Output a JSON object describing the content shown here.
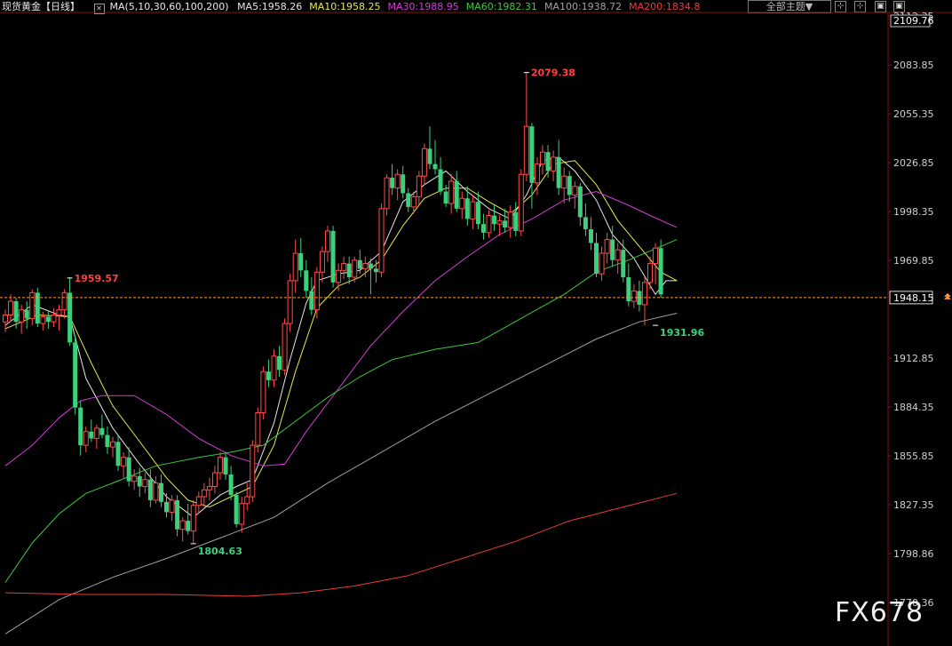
{
  "header": {
    "title": "现货黄金",
    "period": "【日线】",
    "ma_params": "MA(5,10,30,60,100,200)",
    "ma_values": [
      {
        "label": "MA5:1958.26",
        "color": "#e6e6e6"
      },
      {
        "label": "MA10:1958.25",
        "color": "#e8e84a"
      },
      {
        "label": "MA30:1988.95",
        "color": "#d43cd4"
      },
      {
        "label": "MA60:1982.31",
        "color": "#3cc83c"
      },
      {
        "label": "MA100:1938.72",
        "color": "#a0a0a0"
      },
      {
        "label": "MA200:1834.8",
        "color": "#e83c3c"
      }
    ],
    "theme_selector": "全部主题▼",
    "tools": [
      "⊹",
      "⊹",
      "▣",
      "▣"
    ]
  },
  "watermark": "FX678",
  "chart_data": {
    "type": "candlestick",
    "title": "",
    "xlabel": "",
    "ylabel": "",
    "ylim": [
      1770.36,
      2112.35
    ],
    "y_ticks": [
      2112.35,
      2083.85,
      2055.35,
      2026.85,
      1998.35,
      1969.85,
      1912.85,
      1884.35,
      1855.85,
      1827.35,
      1798.86,
      1770.36
    ],
    "top_value": "2109.76",
    "current_price": "1948.15",
    "annotations": [
      {
        "text": "2079.38",
        "value": 2079.38,
        "index": 97,
        "color": "#ff4040",
        "kind": "high"
      },
      {
        "text": "1959.57",
        "value": 1959.57,
        "index": 12,
        "color": "#ff4040",
        "kind": "high"
      },
      {
        "text": "1804.63",
        "value": 1804.63,
        "index": 35,
        "color": "#40d080",
        "kind": "low"
      },
      {
        "text": "1931.96",
        "value": 1931.96,
        "index": 121,
        "color": "#40d080",
        "kind": "low"
      }
    ],
    "candles": [
      [
        1934,
        1941,
        1928,
        1938
      ],
      [
        1938,
        1950,
        1934,
        1946
      ],
      [
        1946,
        1948,
        1930,
        1934
      ],
      [
        1934,
        1944,
        1927,
        1941
      ],
      [
        1941,
        1946,
        1930,
        1936
      ],
      [
        1936,
        1953,
        1932,
        1951
      ],
      [
        1951,
        1954,
        1931,
        1933
      ],
      [
        1933,
        1940,
        1929,
        1937
      ],
      [
        1937,
        1940,
        1930,
        1934
      ],
      [
        1934,
        1942,
        1931,
        1938
      ],
      [
        1938,
        1944,
        1929,
        1941
      ],
      [
        1941,
        1953,
        1936,
        1951
      ],
      [
        1951,
        1960,
        1920,
        1922
      ],
      [
        1922,
        1926,
        1880,
        1884
      ],
      [
        1884,
        1888,
        1856,
        1862
      ],
      [
        1862,
        1873,
        1858,
        1870
      ],
      [
        1870,
        1877,
        1864,
        1866
      ],
      [
        1866,
        1874,
        1860,
        1872
      ],
      [
        1872,
        1880,
        1866,
        1868
      ],
      [
        1868,
        1873,
        1857,
        1861
      ],
      [
        1861,
        1867,
        1855,
        1864
      ],
      [
        1864,
        1868,
        1847,
        1850
      ],
      [
        1850,
        1858,
        1843,
        1855
      ],
      [
        1855,
        1861,
        1838,
        1841
      ],
      [
        1841,
        1848,
        1836,
        1844
      ],
      [
        1844,
        1849,
        1832,
        1838
      ],
      [
        1838,
        1846,
        1834,
        1842
      ],
      [
        1842,
        1848,
        1826,
        1830
      ],
      [
        1830,
        1844,
        1828,
        1840
      ],
      [
        1840,
        1845,
        1826,
        1829
      ],
      [
        1829,
        1834,
        1820,
        1823
      ],
      [
        1823,
        1833,
        1818,
        1830
      ],
      [
        1830,
        1833,
        1809,
        1813
      ],
      [
        1813,
        1820,
        1806,
        1818
      ],
      [
        1818,
        1828,
        1810,
        1812
      ],
      [
        1812,
        1830,
        1805,
        1827
      ],
      [
        1827,
        1835,
        1822,
        1832
      ],
      [
        1832,
        1840,
        1826,
        1836
      ],
      [
        1836,
        1843,
        1830,
        1838
      ],
      [
        1838,
        1850,
        1834,
        1846
      ],
      [
        1846,
        1858,
        1842,
        1855
      ],
      [
        1855,
        1858,
        1842,
        1845
      ],
      [
        1845,
        1850,
        1830,
        1833
      ],
      [
        1833,
        1835,
        1814,
        1816
      ],
      [
        1816,
        1832,
        1811,
        1828
      ],
      [
        1828,
        1840,
        1824,
        1832
      ],
      [
        1832,
        1865,
        1829,
        1862
      ],
      [
        1862,
        1884,
        1858,
        1881
      ],
      [
        1881,
        1908,
        1877,
        1905
      ],
      [
        1905,
        1912,
        1896,
        1900
      ],
      [
        1900,
        1918,
        1896,
        1914
      ],
      [
        1914,
        1920,
        1902,
        1906
      ],
      [
        1906,
        1936,
        1903,
        1933
      ],
      [
        1933,
        1962,
        1928,
        1958
      ],
      [
        1958,
        1982,
        1951,
        1974
      ],
      [
        1974,
        1983,
        1960,
        1964
      ],
      [
        1964,
        1970,
        1948,
        1952
      ],
      [
        1952,
        1960,
        1938,
        1941
      ],
      [
        1941,
        1966,
        1936,
        1963
      ],
      [
        1963,
        1978,
        1957,
        1975
      ],
      [
        1975,
        1990,
        1969,
        1987
      ],
      [
        1987,
        1990,
        1954,
        1957
      ],
      [
        1957,
        1968,
        1952,
        1964
      ],
      [
        1964,
        1972,
        1959,
        1968
      ],
      [
        1968,
        1972,
        1956,
        1960
      ],
      [
        1960,
        1972,
        1957,
        1970
      ],
      [
        1970,
        1976,
        1962,
        1965
      ],
      [
        1965,
        1972,
        1960,
        1968
      ],
      [
        1968,
        1971,
        1950,
        1965
      ],
      [
        1965,
        1970,
        1957,
        1963
      ],
      [
        1963,
        2003,
        1960,
        2000
      ],
      [
        2000,
        2020,
        1996,
        2018
      ],
      [
        2018,
        2026,
        2008,
        2012
      ],
      [
        2012,
        2023,
        2005,
        2020
      ],
      [
        2020,
        2025,
        2006,
        2009
      ],
      [
        2009,
        2012,
        1998,
        2001
      ],
      [
        2001,
        2010,
        1997,
        2007
      ],
      [
        2007,
        2022,
        2002,
        2019
      ],
      [
        2019,
        2038,
        2014,
        2035
      ],
      [
        2035,
        2048,
        2023,
        2026
      ],
      [
        2026,
        2040,
        2020,
        2023
      ],
      [
        2023,
        2030,
        2008,
        2010
      ],
      [
        2010,
        2014,
        2001,
        2003
      ],
      [
        2003,
        2020,
        1997,
        2016
      ],
      [
        2016,
        2022,
        1998,
        2000
      ],
      [
        2000,
        2010,
        1994,
        2006
      ],
      [
        2006,
        2013,
        1990,
        1994
      ],
      [
        1994,
        2008,
        1988,
        2004
      ],
      [
        2004,
        2010,
        1988,
        1991
      ],
      [
        1991,
        1997,
        1982,
        1986
      ],
      [
        1986,
        1999,
        1983,
        1996
      ],
      [
        1996,
        2002,
        1987,
        1991
      ],
      [
        1991,
        1996,
        1984,
        1993
      ],
      [
        1993,
        2000,
        1986,
        1989
      ],
      [
        1989,
        2002,
        1983,
        1998
      ],
      [
        1998,
        2004,
        1984,
        1987
      ],
      [
        1987,
        2023,
        1984,
        2020
      ],
      [
        2020,
        2079,
        2016,
        2048
      ],
      [
        2048,
        2050,
        2000,
        2015
      ],
      [
        2015,
        2030,
        2008,
        2026
      ],
      [
        2026,
        2037,
        2020,
        2033
      ],
      [
        2033,
        2037,
        2018,
        2022
      ],
      [
        2022,
        2034,
        2016,
        2030
      ],
      [
        2030,
        2040,
        2008,
        2012
      ],
      [
        2012,
        2024,
        2003,
        2019
      ],
      [
        2019,
        2022,
        2004,
        2008
      ],
      [
        2008,
        2016,
        2000,
        2013
      ],
      [
        2013,
        2015,
        1990,
        1995
      ],
      [
        1995,
        2003,
        1984,
        1988
      ],
      [
        1988,
        1995,
        1976,
        1980
      ],
      [
        1980,
        1986,
        1960,
        1962
      ],
      [
        1962,
        1978,
        1958,
        1974
      ],
      [
        1974,
        1986,
        1968,
        1982
      ],
      [
        1982,
        1990,
        1966,
        1970
      ],
      [
        1970,
        1980,
        1962,
        1976
      ],
      [
        1976,
        1982,
        1957,
        1960
      ],
      [
        1960,
        1968,
        1943,
        1946
      ],
      [
        1946,
        1956,
        1942,
        1952
      ],
      [
        1952,
        1958,
        1940,
        1944
      ],
      [
        1944,
        1960,
        1932,
        1957
      ],
      [
        1957,
        1972,
        1953,
        1968
      ],
      [
        1968,
        1980,
        1956,
        1977
      ],
      [
        1977,
        1982,
        1948,
        1950
      ]
    ],
    "ma_series": [
      {
        "name": "MA5",
        "color": "#e6e6e6",
        "points": [
          [
            0,
            1932
          ],
          [
            5,
            1944
          ],
          [
            10,
            1938
          ],
          [
            12,
            1937
          ],
          [
            15,
            1901
          ],
          [
            20,
            1872
          ],
          [
            25,
            1851
          ],
          [
            30,
            1832
          ],
          [
            35,
            1820
          ],
          [
            40,
            1833
          ],
          [
            43,
            1838
          ],
          [
            46,
            1842
          ],
          [
            50,
            1875
          ],
          [
            53,
            1912
          ],
          [
            56,
            1945
          ],
          [
            58,
            1958
          ],
          [
            62,
            1962
          ],
          [
            66,
            1964
          ],
          [
            70,
            1975
          ],
          [
            74,
            2004
          ],
          [
            78,
            2014
          ],
          [
            82,
            2022
          ],
          [
            86,
            2010
          ],
          [
            90,
            2000
          ],
          [
            94,
            1994
          ],
          [
            97,
            2008
          ],
          [
            100,
            2028
          ],
          [
            103,
            2030
          ],
          [
            106,
            2022
          ],
          [
            110,
            2005
          ],
          [
            113,
            1985
          ],
          [
            117,
            1971
          ],
          [
            121,
            1950
          ],
          [
            123,
            1958
          ],
          [
            125,
            1958
          ]
        ]
      },
      {
        "name": "MA10",
        "color": "#e8e84a",
        "points": [
          [
            0,
            1930
          ],
          [
            6,
            1938
          ],
          [
            12,
            1937
          ],
          [
            16,
            1910
          ],
          [
            20,
            1885
          ],
          [
            26,
            1860
          ],
          [
            30,
            1843
          ],
          [
            34,
            1830
          ],
          [
            38,
            1826
          ],
          [
            42,
            1832
          ],
          [
            46,
            1838
          ],
          [
            50,
            1862
          ],
          [
            54,
            1905
          ],
          [
            58,
            1942
          ],
          [
            62,
            1955
          ],
          [
            66,
            1960
          ],
          [
            70,
            1970
          ],
          [
            74,
            1990
          ],
          [
            78,
            2006
          ],
          [
            82,
            2012
          ],
          [
            86,
            2012
          ],
          [
            90,
            2004
          ],
          [
            94,
            1997
          ],
          [
            98,
            2008
          ],
          [
            102,
            2026
          ],
          [
            106,
            2028
          ],
          [
            110,
            2014
          ],
          [
            114,
            1993
          ],
          [
            118,
            1978
          ],
          [
            122,
            1963
          ],
          [
            125,
            1958
          ]
        ]
      },
      {
        "name": "MA30",
        "color": "#d43cd4",
        "points": [
          [
            0,
            1850
          ],
          [
            5,
            1862
          ],
          [
            10,
            1878
          ],
          [
            14,
            1888
          ],
          [
            18,
            1891
          ],
          [
            24,
            1891
          ],
          [
            30,
            1880
          ],
          [
            36,
            1866
          ],
          [
            42,
            1856
          ],
          [
            48,
            1850
          ],
          [
            52,
            1851
          ],
          [
            56,
            1870
          ],
          [
            62,
            1895
          ],
          [
            68,
            1920
          ],
          [
            74,
            1940
          ],
          [
            80,
            1958
          ],
          [
            86,
            1972
          ],
          [
            92,
            1985
          ],
          [
            98,
            1994
          ],
          [
            104,
            2005
          ],
          [
            110,
            2010
          ],
          [
            116,
            2002
          ],
          [
            120,
            1996
          ],
          [
            125,
            1989
          ]
        ]
      },
      {
        "name": "MA60",
        "color": "#3cc83c",
        "points": [
          [
            0,
            1782
          ],
          [
            5,
            1805
          ],
          [
            10,
            1822
          ],
          [
            15,
            1834
          ],
          [
            20,
            1840
          ],
          [
            28,
            1850
          ],
          [
            36,
            1855
          ],
          [
            42,
            1858
          ],
          [
            48,
            1862
          ],
          [
            54,
            1876
          ],
          [
            60,
            1890
          ],
          [
            66,
            1902
          ],
          [
            72,
            1912
          ],
          [
            80,
            1918
          ],
          [
            88,
            1922
          ],
          [
            96,
            1936
          ],
          [
            104,
            1950
          ],
          [
            110,
            1963
          ],
          [
            116,
            1970
          ],
          [
            122,
            1978
          ],
          [
            125,
            1982
          ]
        ]
      },
      {
        "name": "MA100",
        "color": "#a0a0a0",
        "points": [
          [
            0,
            1752
          ],
          [
            10,
            1772
          ],
          [
            20,
            1785
          ],
          [
            30,
            1796
          ],
          [
            40,
            1808
          ],
          [
            50,
            1820
          ],
          [
            60,
            1840
          ],
          [
            70,
            1858
          ],
          [
            80,
            1876
          ],
          [
            90,
            1892
          ],
          [
            100,
            1908
          ],
          [
            110,
            1924
          ],
          [
            118,
            1934
          ],
          [
            125,
            1939
          ]
        ]
      },
      {
        "name": "MA200",
        "color": "#e83c3c",
        "points": [
          [
            0,
            1776
          ],
          [
            15,
            1775
          ],
          [
            30,
            1775
          ],
          [
            45,
            1774
          ],
          [
            55,
            1776
          ],
          [
            65,
            1780
          ],
          [
            75,
            1786
          ],
          [
            85,
            1796
          ],
          [
            95,
            1806
          ],
          [
            105,
            1818
          ],
          [
            115,
            1826
          ],
          [
            125,
            1834
          ]
        ]
      }
    ],
    "grid": false,
    "candle_up_color": "#ff4c4c",
    "candle_down_color": "#3ccf7c",
    "last_price_line_color": "#ff9933"
  }
}
